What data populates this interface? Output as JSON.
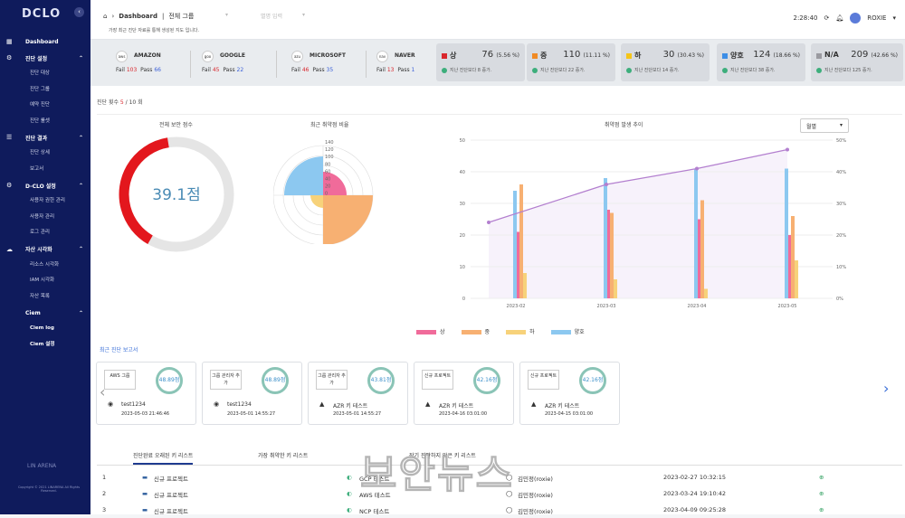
{
  "sidebar": {
    "logo": "DCLO",
    "collapse_icon": "‹",
    "groups": [
      {
        "label": "Dashboard",
        "icon": "grid-icon",
        "items": []
      },
      {
        "label": "진단 설정",
        "icon": "gear-icon",
        "items": [
          "진단 대상",
          "진단 그룹",
          "예약 진단",
          "진단 룰셋"
        ]
      },
      {
        "label": "진단 결과",
        "icon": "list-icon",
        "items": [
          "진단 상세",
          "보고서"
        ]
      },
      {
        "label": "D-CLO 설정",
        "icon": "user-gear-icon",
        "items": [
          "사용자 권한 관리",
          "사용자 관리",
          "로그 관리"
        ]
      },
      {
        "label": "자산 시각화",
        "icon": "cloud-icon",
        "items": [
          "리소스 시각화",
          "IAM 시각화",
          "자산 목록"
        ]
      },
      {
        "label": "Ciem",
        "icon": "",
        "items": [
          "Ciem log",
          "Ciem 설정"
        ]
      }
    ],
    "footer_brand": "LIN ARENA",
    "copyright": "Copyright © 2021 LINARENA All Rights Reserved."
  },
  "topbar": {
    "breadcrumb": "Dashboard",
    "group_select": "전체 그룹",
    "input_placeholder": "별명 입력",
    "notice": "가장 최근 진단 자료를 통해 생성된 지도 입니다.",
    "time": "2:28:40",
    "user": "ROXIE"
  },
  "clouds": [
    {
      "name": "AMAZON",
      "icon": "aws",
      "fail": "103",
      "pass": "66"
    },
    {
      "name": "GOOGLE",
      "icon": "google-cloud",
      "fail": "45",
      "pass": "22"
    },
    {
      "name": "MICROSOFT",
      "icon": "azure",
      "fail": "46",
      "pass": "35"
    },
    {
      "name": "NAVER",
      "icon": "naver",
      "fail": "13",
      "pass": "1"
    }
  ],
  "fail_label": "Fail",
  "pass_label": "Pass",
  "severity": [
    {
      "label": "상",
      "value": "76",
      "pct": "(5.56 %)",
      "sub": "지난 진단보다 8 증가.",
      "color": "#d9262c"
    },
    {
      "label": "중",
      "value": "110",
      "pct": "(11.11 %)",
      "sub": "지난 진단보다 22 증가.",
      "color": "#f08a24"
    },
    {
      "label": "하",
      "value": "30",
      "pct": "(30.43 %)",
      "sub": "지난 진단보다 14 증가.",
      "color": "#f5c518"
    },
    {
      "label": "양호",
      "value": "124",
      "pct": "(18.66 %)",
      "sub": "지난 진단보다 38 증가.",
      "color": "#3d8ee6"
    },
    {
      "label": "N/A",
      "value": "209",
      "pct": "(42.66 %)",
      "sub": "지난 진단보다 125 증가.",
      "color": "#9a9aa0"
    }
  ],
  "diag_count": {
    "label": "진단 횟수",
    "current": "5",
    "total": "10",
    "unit": "회"
  },
  "score": {
    "title": "전체 보안 점수",
    "value": "39.1점",
    "fraction": 0.391
  },
  "radar": {
    "title": "최근 취약점 비율",
    "ticks": [
      "140",
      "120",
      "100",
      "80",
      "60",
      "40",
      "20",
      "0"
    ]
  },
  "trend": {
    "title": "취약점 발생 추이",
    "period": "월별"
  },
  "chart_data": {
    "type": "bar",
    "categories": [
      "2023-02",
      "2023-03",
      "2023-04",
      "2023-05"
    ],
    "series": [
      {
        "name": "상",
        "color": "#f06b9a",
        "values": [
          21,
          28,
          25,
          20
        ]
      },
      {
        "name": "중",
        "color": "#f7b072",
        "values": [
          36,
          27,
          31,
          26
        ]
      },
      {
        "name": "하",
        "color": "#f7d27a",
        "values": [
          8,
          6,
          3,
          12
        ]
      },
      {
        "name": "양호",
        "color": "#8cc8f0",
        "values": [
          34,
          38,
          41,
          41
        ]
      }
    ],
    "line": {
      "values": [
        24,
        36,
        41,
        47
      ],
      "axis": "right"
    },
    "ylim": [
      0,
      50
    ],
    "yticks": [
      "50",
      "40",
      "30",
      "20",
      "10",
      "0"
    ],
    "y2ticks": [
      "50%",
      "40%",
      "30%",
      "20%",
      "10%",
      "0%"
    ]
  },
  "recent": {
    "title": "최근 진단 보고서",
    "cards": [
      {
        "tag": "AWS 그룹",
        "score": "48.89점",
        "name": "test1234",
        "date": "2023-05-03 21:46:46",
        "icon": "aws"
      },
      {
        "tag": "그룹 관리자 추가",
        "score": "48.89점",
        "name": "test1234",
        "date": "2023-05-01 14:55:27",
        "icon": "aws"
      },
      {
        "tag": "그룹 관리자 추가",
        "score": "43.81점",
        "name": "AZR 키 테스트",
        "date": "2023-05-01 14:55:27",
        "icon": "azure"
      },
      {
        "tag": "신규 프로젝트",
        "score": "42.16점",
        "name": "AZR 키 테스트",
        "date": "2023-04-16 03:01:00",
        "icon": "azure"
      },
      {
        "tag": "신규 프로젝트",
        "score": "42.16점",
        "name": "AZR 키 테스트",
        "date": "2023-04-15 03:01:00",
        "icon": "azure"
      }
    ]
  },
  "bottom_tabs": [
    "진단완료 오래된 키 리스트",
    "가장 취약한 키 리스트",
    "장기 진단하지 않은 키 리스트"
  ],
  "rows": [
    {
      "n": "1",
      "proj": "신규 프로젝트",
      "key": "GCP 테스트",
      "user": "김민정(roxie)",
      "date": "2023-02-27 10:32:15"
    },
    {
      "n": "2",
      "proj": "신규 프로젝트",
      "key": "AWS 테스트",
      "user": "김민정(roxie)",
      "date": "2023-03-24 19:10:42"
    },
    {
      "n": "3",
      "proj": "신규 프로젝트",
      "key": "NCP 테스트",
      "user": "김민정(roxie)",
      "date": "2023-04-09 09:25:28"
    }
  ],
  "watermark": "보안뉴스"
}
